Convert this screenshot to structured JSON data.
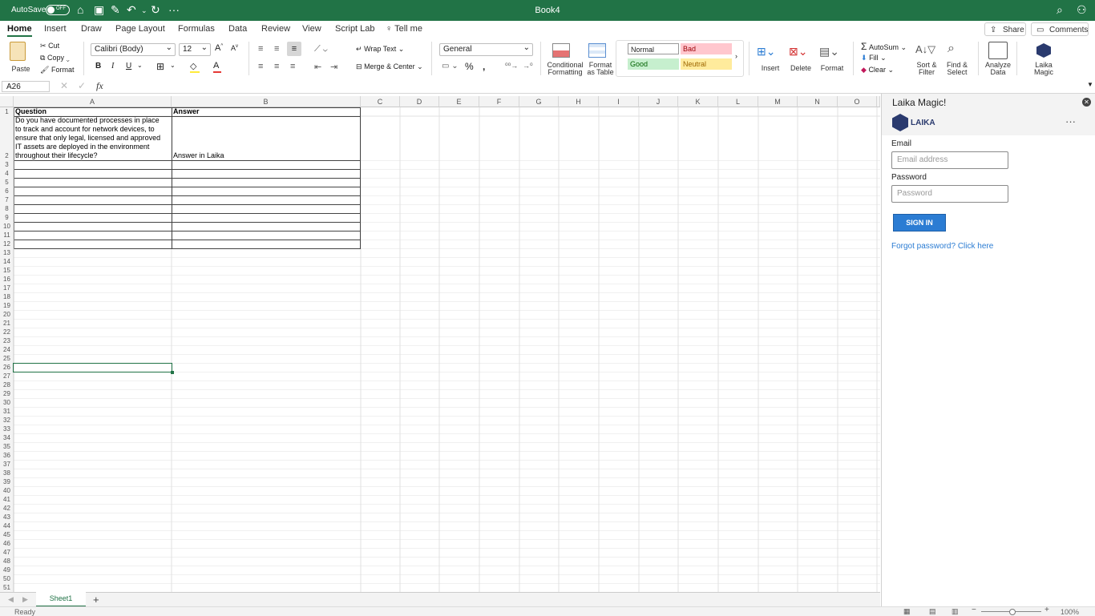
{
  "titlebar": {
    "autosave_label": "AutoSave",
    "autosave_state": "OFF",
    "document_title": "Book4"
  },
  "tabs": [
    "Home",
    "Insert",
    "Draw",
    "Page Layout",
    "Formulas",
    "Data",
    "Review",
    "View",
    "Script Lab"
  ],
  "tell_me": "Tell me",
  "share_label": "Share",
  "comments_label": "Comments",
  "ribbon": {
    "paste": "Paste",
    "cut": "Cut",
    "copy": "Copy",
    "format_painter": "Format",
    "font_name": "Calibri (Body)",
    "font_size": "12",
    "bold": "B",
    "italic": "I",
    "underline": "U",
    "wrap_text": "Wrap Text",
    "merge_center": "Merge & Center",
    "number_format": "General",
    "conditional_formatting": [
      "Conditional",
      "Formatting"
    ],
    "format_as_table": [
      "Format",
      "as Table"
    ],
    "styles": {
      "normal": "Normal",
      "bad": "Bad",
      "good": "Good",
      "neutral": "Neutral"
    },
    "insert": "Insert",
    "delete": "Delete",
    "format": "Format",
    "autosum": "AutoSum",
    "fill": "Fill",
    "clear": "Clear",
    "sort_filter": [
      "Sort &",
      "Filter"
    ],
    "find_select": [
      "Find &",
      "Select"
    ],
    "analyze_data": [
      "Analyze",
      "Data"
    ],
    "laika_magic": [
      "Laika",
      "Magic"
    ]
  },
  "formula_bar": {
    "name_box": "A26",
    "fx": "fx"
  },
  "sheet": {
    "columns": [
      "A",
      "B",
      "C",
      "D",
      "E",
      "F",
      "G",
      "H",
      "I",
      "J",
      "K",
      "L",
      "M",
      "N",
      "O"
    ],
    "header_question": "Question",
    "header_answer": "Answer",
    "question_lines": [
      "Do you have documented processes in place",
      "to track and account for network devices, to",
      "ensure that only legal, licensed and approved",
      "IT assets are deployed in the environment",
      "throughout their lifecycle?"
    ],
    "answer_value": "Answer in Laika",
    "selected_cell": "A26"
  },
  "sheet_tabs": {
    "active": "Sheet1",
    "add": "+"
  },
  "status": {
    "left": "Ready",
    "zoom": "100%"
  },
  "pane": {
    "title": "Laika Magic!",
    "brand": "LAIKA",
    "email_label": "Email",
    "email_placeholder": "Email address",
    "password_label": "Password",
    "password_placeholder": "Password",
    "signin_label": "SIGN IN",
    "forgot_link": "Forgot password? Click here"
  },
  "colors": {
    "excel_green": "#217346",
    "link_blue": "#2b7cd3"
  }
}
